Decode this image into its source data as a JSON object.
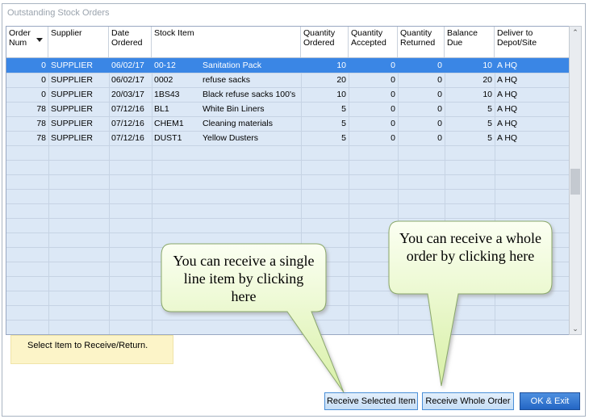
{
  "window": {
    "title": "Outstanding Stock Orders"
  },
  "table": {
    "columns": [
      "Order Num",
      "Supplier",
      "Date Ordered",
      "Stock Item",
      "",
      "Quantity Ordered",
      "Quantity Accepted",
      "Quantity Returned",
      "Balance Due",
      "Deliver to Depot/Site"
    ],
    "rows": [
      [
        "0",
        "SUPPLIER",
        "06/02/17",
        "00-12",
        "Sanitation Pack",
        "10",
        "0",
        "0",
        "10",
        "A HQ"
      ],
      [
        "0",
        "SUPPLIER",
        "06/02/17",
        "0002",
        "refuse sacks",
        "20",
        "0",
        "0",
        "20",
        "A HQ"
      ],
      [
        "0",
        "SUPPLIER",
        "20/03/17",
        "1BS43",
        "Black refuse sacks 100's",
        "10",
        "0",
        "0",
        "10",
        "A HQ"
      ],
      [
        "78",
        "SUPPLIER",
        "07/12/16",
        "BL1",
        "White Bin Liners",
        "5",
        "0",
        "0",
        "5",
        "A HQ"
      ],
      [
        "78",
        "SUPPLIER",
        "07/12/16",
        "CHEM1",
        "Cleaning materials",
        "5",
        "0",
        "0",
        "5",
        "A HQ"
      ],
      [
        "78",
        "SUPPLIER",
        "07/12/16",
        "DUST1",
        "Yellow Dusters",
        "5",
        "0",
        "0",
        "5",
        "A HQ"
      ]
    ],
    "selected_row": 0
  },
  "status": {
    "text": "Select Item to Receive/Return."
  },
  "buttons": {
    "receive_selected": "Receive Selected Item",
    "receive_whole": "Receive Whole Order",
    "ok_exit": "OK & Exit"
  },
  "callouts": {
    "single": "You can receive a single line item by clicking here",
    "whole": "You can receive a whole order by clicking here"
  },
  "colors": {
    "selected_row": "#3a86e5",
    "grid_bg": "#dce8f6",
    "callout_fill": "#eaf8c8",
    "status_bg": "#fcf4c8"
  },
  "icons": {
    "sort": "sort-desc-icon",
    "scroll_up": "chevron-up-icon",
    "scroll_down": "chevron-down-icon"
  }
}
